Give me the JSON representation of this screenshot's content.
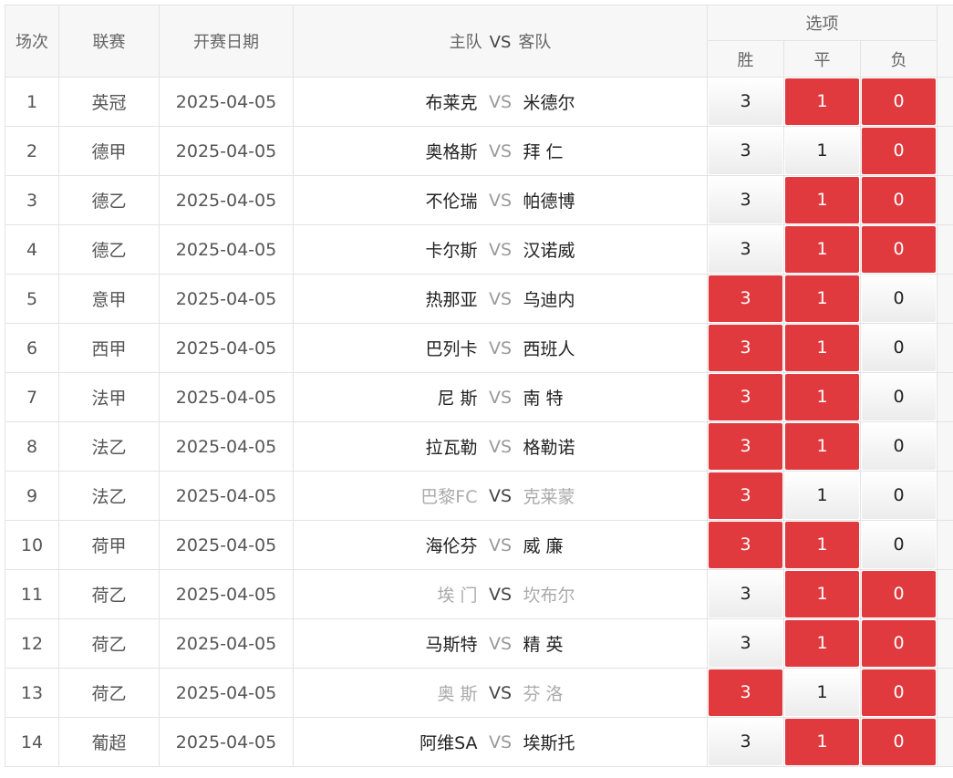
{
  "headers": {
    "no": "场次",
    "league": "联赛",
    "date": "开赛日期",
    "home": "主队",
    "vs": "VS",
    "away": "客队",
    "options": "选项",
    "win": "胜",
    "draw": "平",
    "lose": "负"
  },
  "colors": {
    "selected": "#e0393e"
  },
  "rows": [
    {
      "no": "1",
      "league": "英冠",
      "date": "2025-04-05",
      "home": "布莱克",
      "away": "米德尔",
      "win": "3",
      "draw": "1",
      "lose": "0",
      "sel": [
        false,
        true,
        true
      ],
      "gray": false
    },
    {
      "no": "2",
      "league": "德甲",
      "date": "2025-04-05",
      "home": "奥格斯",
      "away": "拜 仁",
      "win": "3",
      "draw": "1",
      "lose": "0",
      "sel": [
        false,
        false,
        true
      ],
      "gray": false
    },
    {
      "no": "3",
      "league": "德乙",
      "date": "2025-04-05",
      "home": "不伦瑞",
      "away": "帕德博",
      "win": "3",
      "draw": "1",
      "lose": "0",
      "sel": [
        false,
        true,
        true
      ],
      "gray": false
    },
    {
      "no": "4",
      "league": "德乙",
      "date": "2025-04-05",
      "home": "卡尔斯",
      "away": "汉诺威",
      "win": "3",
      "draw": "1",
      "lose": "0",
      "sel": [
        false,
        true,
        true
      ],
      "gray": false
    },
    {
      "no": "5",
      "league": "意甲",
      "date": "2025-04-05",
      "home": "热那亚",
      "away": "乌迪内",
      "win": "3",
      "draw": "1",
      "lose": "0",
      "sel": [
        true,
        true,
        false
      ],
      "gray": false
    },
    {
      "no": "6",
      "league": "西甲",
      "date": "2025-04-05",
      "home": "巴列卡",
      "away": "西班人",
      "win": "3",
      "draw": "1",
      "lose": "0",
      "sel": [
        true,
        true,
        false
      ],
      "gray": false
    },
    {
      "no": "7",
      "league": "法甲",
      "date": "2025-04-05",
      "home": "尼 斯",
      "away": "南 特",
      "win": "3",
      "draw": "1",
      "lose": "0",
      "sel": [
        true,
        true,
        false
      ],
      "gray": false
    },
    {
      "no": "8",
      "league": "法乙",
      "date": "2025-04-05",
      "home": "拉瓦勒",
      "away": "格勒诺",
      "win": "3",
      "draw": "1",
      "lose": "0",
      "sel": [
        true,
        true,
        false
      ],
      "gray": false
    },
    {
      "no": "9",
      "league": "法乙",
      "date": "2025-04-05",
      "home": "巴黎FC",
      "away": "克莱蒙",
      "win": "3",
      "draw": "1",
      "lose": "0",
      "sel": [
        true,
        false,
        false
      ],
      "gray": true
    },
    {
      "no": "10",
      "league": "荷甲",
      "date": "2025-04-05",
      "home": "海伦芬",
      "away": "威 廉",
      "win": "3",
      "draw": "1",
      "lose": "0",
      "sel": [
        true,
        true,
        false
      ],
      "gray": false
    },
    {
      "no": "11",
      "league": "荷乙",
      "date": "2025-04-05",
      "home": "埃 门",
      "away": "坎布尔",
      "win": "3",
      "draw": "1",
      "lose": "0",
      "sel": [
        false,
        true,
        true
      ],
      "gray": true
    },
    {
      "no": "12",
      "league": "荷乙",
      "date": "2025-04-05",
      "home": "马斯特",
      "away": "精 英",
      "win": "3",
      "draw": "1",
      "lose": "0",
      "sel": [
        false,
        true,
        true
      ],
      "gray": false
    },
    {
      "no": "13",
      "league": "荷乙",
      "date": "2025-04-05",
      "home": "奥 斯",
      "away": "芬 洛",
      "win": "3",
      "draw": "1",
      "lose": "0",
      "sel": [
        true,
        false,
        true
      ],
      "gray": true
    },
    {
      "no": "14",
      "league": "葡超",
      "date": "2025-04-05",
      "home": "阿维SA",
      "away": "埃斯托",
      "win": "3",
      "draw": "1",
      "lose": "0",
      "sel": [
        false,
        true,
        true
      ],
      "gray": false
    }
  ]
}
